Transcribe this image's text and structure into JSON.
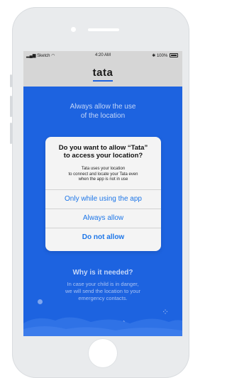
{
  "status_bar": {
    "carrier": "Sketch",
    "time": "4:20 AM",
    "battery": "100%"
  },
  "app": {
    "logo": "tata"
  },
  "background": {
    "title_line1": "Always allow the use",
    "title_line2": "of the location",
    "why_title": "Why is it needed?",
    "why_line1": "In case your child is in danger,",
    "why_line2": "we will send the location to your",
    "why_line3": "emergency contacts."
  },
  "dialog": {
    "title_line1": "Do you want to allow “Tata”",
    "title_line2": "to access your location?",
    "body_line1": "Tata uses your location",
    "body_line2": "to connect and locate your Tata even",
    "body_line3": "when the app is not in use",
    "option_while_using": "Only while using the app",
    "option_always": "Always allow",
    "option_deny": "Do not allow"
  },
  "colors": {
    "screen_background": "#1d63e0",
    "dialog_button_text": "#1d76e8",
    "phone_body": "#e9ebed"
  },
  "icons": {
    "signal": "signal-bars-icon",
    "wifi": "wifi-icon",
    "bluetooth": "bluetooth-icon",
    "battery": "battery-icon"
  }
}
